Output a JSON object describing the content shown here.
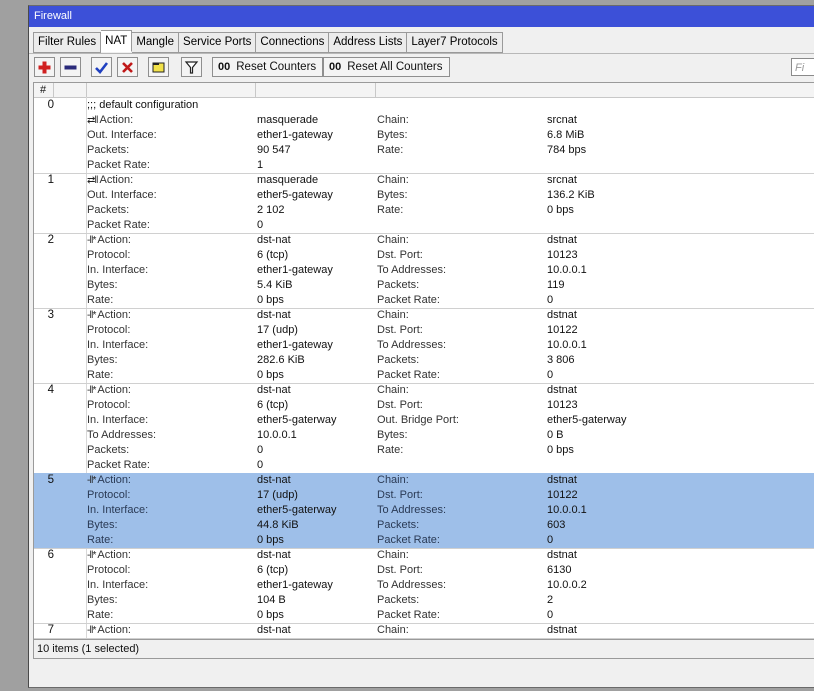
{
  "window": {
    "title": "Firewall"
  },
  "tabs": [
    "Filter Rules",
    "NAT",
    "Mangle",
    "Service Ports",
    "Connections",
    "Address Lists",
    "Layer7 Protocols"
  ],
  "active_tab": "NAT",
  "toolbar": {
    "reset_counters": "Reset Counters",
    "reset_all_counters": "Reset All Counters",
    "oo": "00",
    "find_placeholder": "Fi"
  },
  "table": {
    "header_num": "#",
    "rows": [
      {
        "num": "0",
        "comment": ";;; default configuration",
        "selected": false,
        "lines": [
          [
            "Action:",
            "masquerade",
            "Chain:",
            "srcnat"
          ],
          [
            "Out. Interface:",
            "ether1-gateway",
            "Bytes:",
            "6.8 MiB"
          ],
          [
            "Packets:",
            "90 547",
            "Rate:",
            "784 bps"
          ],
          [
            "Packet Rate:",
            "1",
            "",
            ""
          ]
        ],
        "icon": "⇄‖"
      },
      {
        "num": "1",
        "comment": "",
        "selected": false,
        "lines": [
          [
            "Action:",
            "masquerade",
            "Chain:",
            "srcnat"
          ],
          [
            "Out. Interface:",
            "ether5-gateway",
            "Bytes:",
            "136.2 KiB"
          ],
          [
            "Packets:",
            "2 102",
            "Rate:",
            "0 bps"
          ],
          [
            "Packet Rate:",
            "0",
            "",
            ""
          ]
        ],
        "icon": "⇄‖"
      },
      {
        "num": "2",
        "comment": "",
        "selected": false,
        "lines": [
          [
            "Action:",
            "dst-nat",
            "Chain:",
            "dstnat"
          ],
          [
            "Protocol:",
            "6 (tcp)",
            "Dst. Port:",
            "10123"
          ],
          [
            "In. Interface:",
            "ether1-gateway",
            "To Addresses:",
            "10.0.0.1"
          ],
          [
            "Bytes:",
            "5.4 KiB",
            "Packets:",
            "119"
          ],
          [
            "Rate:",
            "0 bps",
            "Packet Rate:",
            "0"
          ]
        ],
        "icon": "-‖*"
      },
      {
        "num": "3",
        "comment": "",
        "selected": false,
        "lines": [
          [
            "Action:",
            "dst-nat",
            "Chain:",
            "dstnat"
          ],
          [
            "Protocol:",
            "17 (udp)",
            "Dst. Port:",
            "10122"
          ],
          [
            "In. Interface:",
            "ether1-gateway",
            "To Addresses:",
            "10.0.0.1"
          ],
          [
            "Bytes:",
            "282.6 KiB",
            "Packets:",
            "3 806"
          ],
          [
            "Rate:",
            "0 bps",
            "Packet Rate:",
            "0"
          ]
        ],
        "icon": "-‖*"
      },
      {
        "num": "4",
        "comment": "",
        "selected": false,
        "lines": [
          [
            "Action:",
            "dst-nat",
            "Chain:",
            "dstnat"
          ],
          [
            "Protocol:",
            "6 (tcp)",
            "Dst. Port:",
            "10123"
          ],
          [
            "In. Interface:",
            "ether5-gaterway",
            "Out. Bridge Port:",
            "ether5-gaterway"
          ],
          [
            "To Addresses:",
            "10.0.0.1",
            "Bytes:",
            "0 B"
          ],
          [
            "Packets:",
            "0",
            "Rate:",
            "0 bps"
          ],
          [
            "Packet Rate:",
            "0",
            "",
            ""
          ]
        ],
        "icon": "-‖*"
      },
      {
        "num": "5",
        "comment": "",
        "selected": true,
        "lines": [
          [
            "Action:",
            "dst-nat",
            "Chain:",
            "dstnat"
          ],
          [
            "Protocol:",
            "17 (udp)",
            "Dst. Port:",
            "10122"
          ],
          [
            "In. Interface:",
            "ether5-gaterway",
            "To Addresses:",
            "10.0.0.1"
          ],
          [
            "Bytes:",
            "44.8 KiB",
            "Packets:",
            "603"
          ],
          [
            "Rate:",
            "0 bps",
            "Packet Rate:",
            "0"
          ]
        ],
        "icon": "-‖*"
      },
      {
        "num": "6",
        "comment": "",
        "selected": false,
        "lines": [
          [
            "Action:",
            "dst-nat",
            "Chain:",
            "dstnat"
          ],
          [
            "Protocol:",
            "6 (tcp)",
            "Dst. Port:",
            "6130"
          ],
          [
            "In. Interface:",
            "ether1-gateway",
            "To Addresses:",
            "10.0.0.2"
          ],
          [
            "Bytes:",
            "104 B",
            "Packets:",
            "2"
          ],
          [
            "Rate:",
            "0 bps",
            "Packet Rate:",
            "0"
          ]
        ],
        "icon": "-‖*"
      },
      {
        "num": "7",
        "comment": "",
        "selected": false,
        "lines": [
          [
            "Action:",
            "dst-nat",
            "Chain:",
            "dstnat"
          ]
        ],
        "icon": "-‖*"
      }
    ]
  },
  "status": "10 items (1 selected)",
  "colors": {
    "titlebar": "#3c50d8",
    "selection": "#9ebfe9",
    "add": "#d02020",
    "check": "#2040c0"
  }
}
